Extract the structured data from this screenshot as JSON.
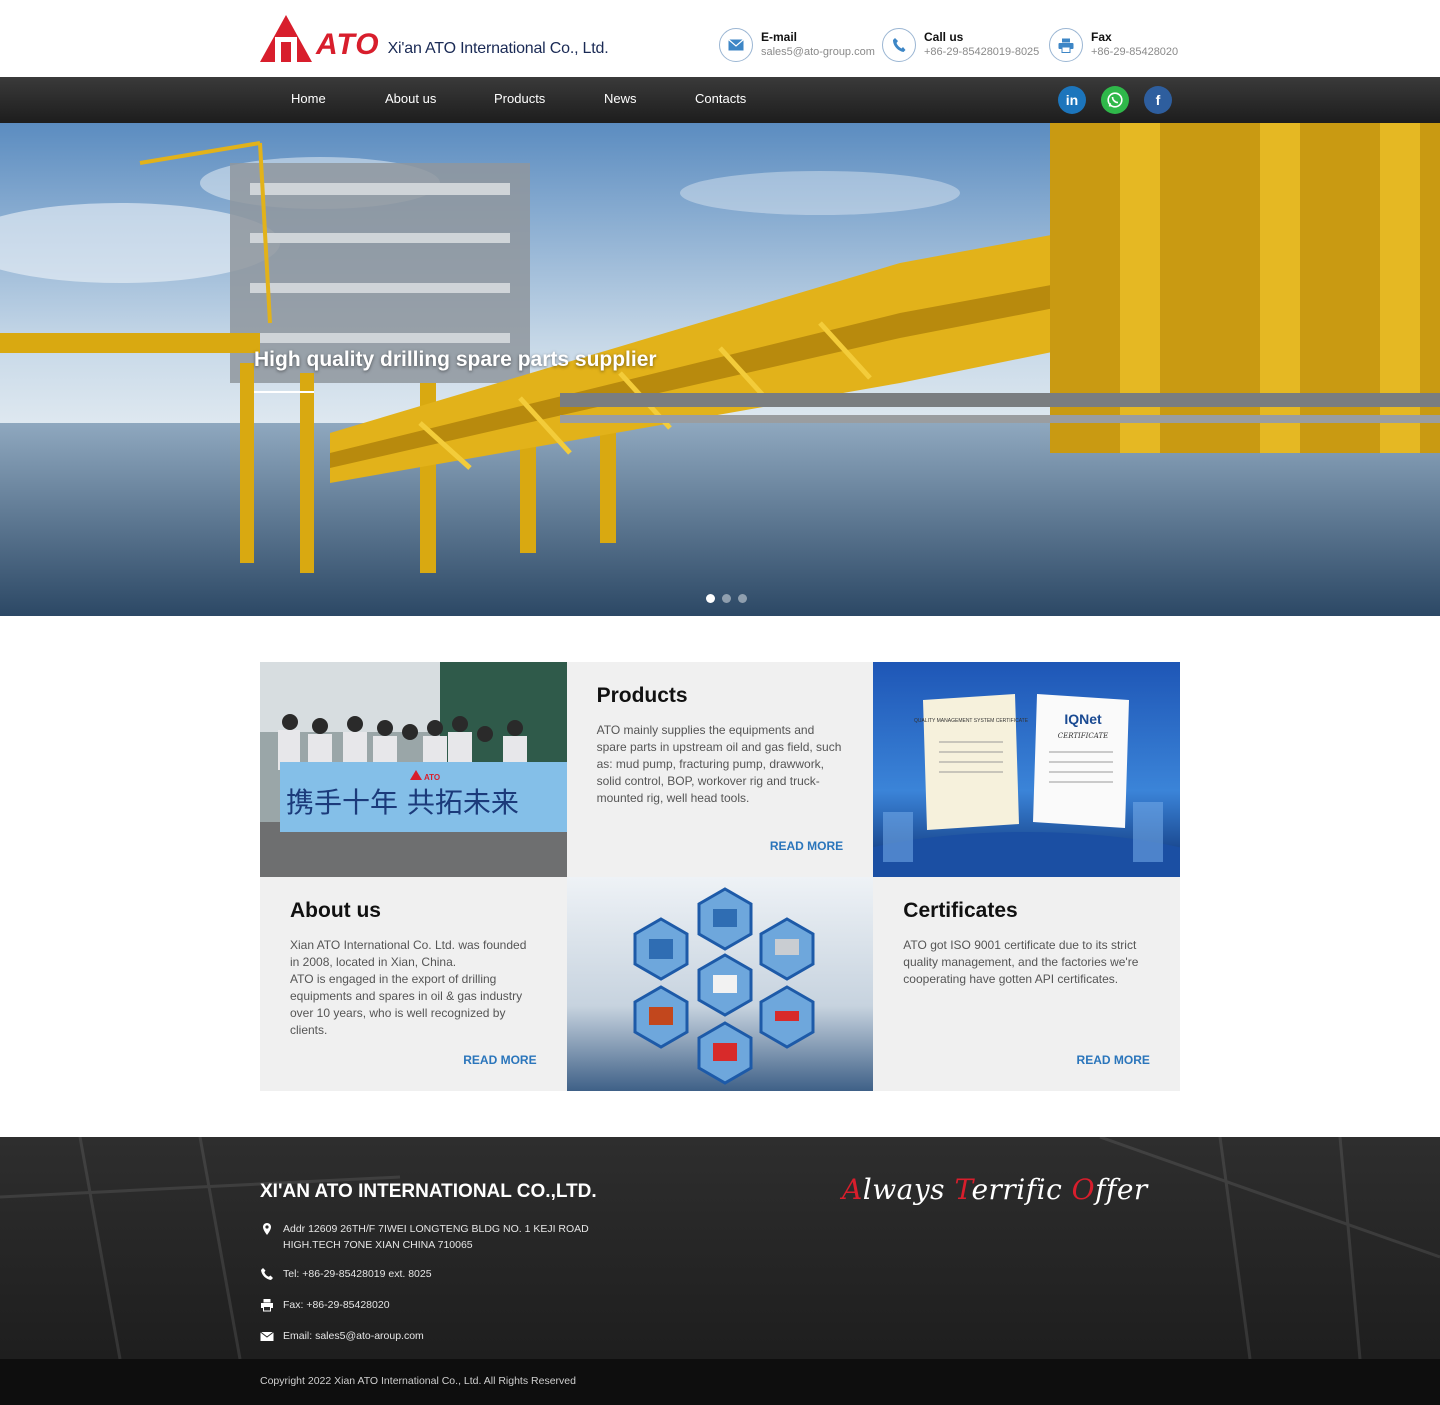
{
  "header": {
    "company_name": "Xi'an ATO International Co., Ltd.",
    "logo_text": "ATO",
    "contacts": [
      {
        "label": "E-mail",
        "value": "sales5@ato-group.com",
        "icon": "envelope-icon"
      },
      {
        "label": "Call us",
        "value": "+86-29-85428019-8025",
        "icon": "phone-icon"
      },
      {
        "label": "Fax",
        "value": "+86-29-85428020",
        "icon": "fax-icon"
      }
    ]
  },
  "nav": {
    "items": [
      "Home",
      "About us",
      "Products",
      "News",
      "Contacts"
    ],
    "social": [
      {
        "icon": "linkedin-icon",
        "glyph": "in",
        "color": "#1c75bc"
      },
      {
        "icon": "whatsapp-icon",
        "glyph": "",
        "color": "#2fb84a"
      },
      {
        "icon": "facebook-icon",
        "glyph": "f",
        "color": "#2e5e9e"
      }
    ]
  },
  "hero": {
    "title": "High quality drilling spare parts supplier",
    "slide_count": 3,
    "active_slide": 0
  },
  "sections": {
    "products": {
      "title": "Products",
      "body": "ATO mainly supplies the equipments and spare parts in upstream oil and gas field, such as: mud pump, fracturing pump, drawwork, solid control, BOP, workover rig and truck-mounted rig, well head tools.",
      "link": "READ MORE"
    },
    "about": {
      "title": "About us",
      "body_1": "Xian ATO International Co. Ltd. was founded in 2008, located in Xian, China.",
      "body_2": "ATO is engaged in the export of drilling equipments and spares in oil & gas industry over 10 years, who is well recognized by clients.",
      "link": "READ MORE"
    },
    "certificates": {
      "title": "Certificates",
      "body": "ATO got ISO 9001 certificate due to its strict quality management, and the factories we're cooperating have gotten API certificates.",
      "link": "READ MORE"
    },
    "team_photo": {
      "banner_text": "携手十年 共拓未来",
      "banner_logo": "ATO"
    },
    "cert_photo": {
      "left_cert_title": "QUALITY MANAGEMENT SYSTEM CERTIFICATE",
      "right_cert_brand": "IQNet",
      "right_cert_title": "CERTIFICATE"
    }
  },
  "footer": {
    "company": "XI'AN ATO INTERNATIONAL CO.,LTD.",
    "address_line1": "Addr 12609 26TH/F 7IWEI LONGTENG BLDG NO. 1 KEJI ROAD",
    "address_line2": "HIGH.TECH 7ONE XIAN CHINA 710065",
    "tel": "Tel: +86-29-85428019 ext. 8025",
    "fax": "Fax: +86-29-85428020",
    "email": "Email: sales5@ato-aroup.com",
    "slogan": [
      {
        "initial": "A",
        "rest": "lways "
      },
      {
        "initial": "T",
        "rest": "errific "
      },
      {
        "initial": "O",
        "rest": "ffer"
      }
    ],
    "copyright": "Copyright 2022 Xian ATO International Co., Ltd. All Rights Reserved"
  },
  "colors": {
    "brand_red": "#d81e2c",
    "brand_navy": "#1a2a55",
    "link_blue": "#2a75bb",
    "nav_dark": "#2a2a2a"
  }
}
